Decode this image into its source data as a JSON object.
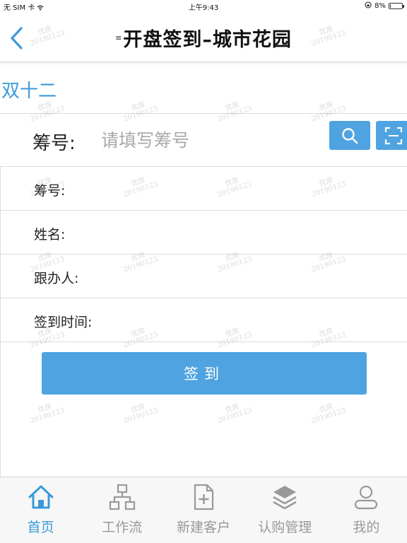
{
  "status_bar": {
    "carrier": "无 SIM 卡",
    "time": "上午9:43",
    "battery_percent": "8%",
    "battery_level": 0.08
  },
  "nav": {
    "menu_glyph": "≡",
    "title": "开盘签到–城市花园",
    "back_icon": "chevron-left-icon"
  },
  "project_label": "双十二",
  "search": {
    "label": "筹号:",
    "placeholder": "请填写筹号",
    "value": "",
    "search_icon": "search-icon",
    "scan_icon": "scan-icon"
  },
  "form_rows": [
    {
      "label": "筹号:",
      "value": ""
    },
    {
      "label": "姓名:",
      "value": ""
    },
    {
      "label": "跟办人:",
      "value": ""
    },
    {
      "label": "签到时间:",
      "value": ""
    }
  ],
  "submit_label": "签到",
  "tabs": [
    {
      "label": "首页",
      "icon": "home-icon",
      "active": true
    },
    {
      "label": "工作流",
      "icon": "workflow-icon",
      "active": false
    },
    {
      "label": "新建客户",
      "icon": "new-customer-icon",
      "active": false
    },
    {
      "label": "认购管理",
      "icon": "layers-icon",
      "active": false
    },
    {
      "label": "我的",
      "icon": "user-icon",
      "active": false
    }
  ],
  "watermark": {
    "line1": "优房",
    "line2": "20190123"
  },
  "colors": {
    "accent": "#3b9ad9",
    "button": "#4fa3e0",
    "inactive": "#999999"
  }
}
